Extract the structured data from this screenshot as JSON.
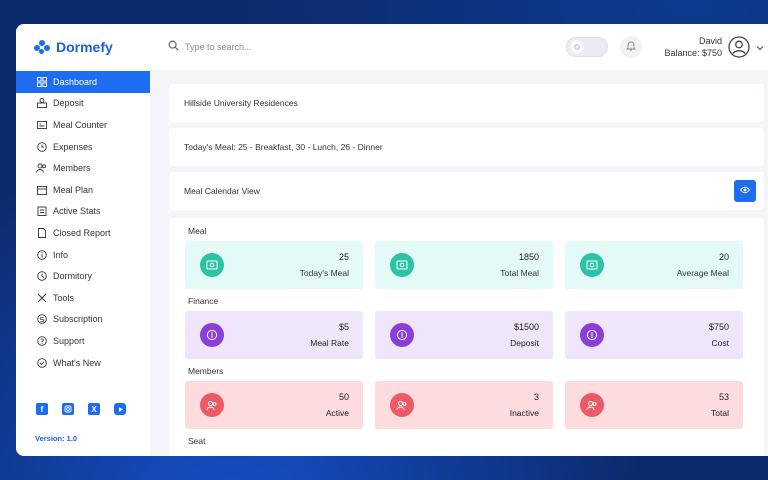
{
  "app": {
    "name": "Dormefy",
    "version": "Version: 1.0"
  },
  "search": {
    "placeholder": "Type to search..."
  },
  "user": {
    "name": "David",
    "balance": "Balance: $750"
  },
  "sidebar": {
    "items": [
      {
        "label": "Dashboard",
        "icon": "grid-icon",
        "active": true
      },
      {
        "label": "Deposit",
        "icon": "deposit-icon"
      },
      {
        "label": "Meal Counter",
        "icon": "counter-icon"
      },
      {
        "label": "Expenses",
        "icon": "expenses-icon"
      },
      {
        "label": "Members",
        "icon": "members-icon"
      },
      {
        "label": "Meal Plan",
        "icon": "calendar-icon"
      },
      {
        "label": "Active Stats",
        "icon": "clipboard-icon"
      },
      {
        "label": "Closed Report",
        "icon": "report-icon"
      },
      {
        "label": "Info",
        "icon": "info-icon"
      },
      {
        "label": "Dormitory",
        "icon": "dormitory-icon"
      },
      {
        "label": "Tools",
        "icon": "tools-icon"
      },
      {
        "label": "Subscription",
        "icon": "subscription-icon"
      },
      {
        "label": "Support",
        "icon": "support-icon"
      },
      {
        "label": "What's New",
        "icon": "check-circle-icon"
      }
    ],
    "socials": [
      "facebook-icon",
      "instagram-icon",
      "x-icon",
      "youtube-icon"
    ]
  },
  "main": {
    "residence": "Hillside University Residences",
    "todays_meal": "Today's Meal: 25 - Breakfast, 30 - Lunch, 26 - Dinner",
    "calendar_view": "Meal Calendar View",
    "sections": {
      "meal": "Meal",
      "finance": "Finance",
      "members": "Members",
      "seat": "Seat"
    },
    "meal_cards": [
      {
        "value": "25",
        "label": "Today's Meal"
      },
      {
        "value": "1850",
        "label": "Total Meal"
      },
      {
        "value": "20",
        "label": "Average Meal"
      }
    ],
    "finance_cards": [
      {
        "value": "$5",
        "label": "Meal Rate"
      },
      {
        "value": "$1500",
        "label": "Deposit"
      },
      {
        "value": "$750",
        "label": "Cost"
      }
    ],
    "member_cards": [
      {
        "value": "50",
        "label": "Active"
      },
      {
        "value": "3",
        "label": "Inactive"
      },
      {
        "value": "53",
        "label": "Total"
      }
    ]
  },
  "colors": {
    "primary": "#1e6cf0",
    "meal_card": "#e4faf6",
    "finance_card": "#efe6fb",
    "member_card": "#fcdcdf"
  }
}
